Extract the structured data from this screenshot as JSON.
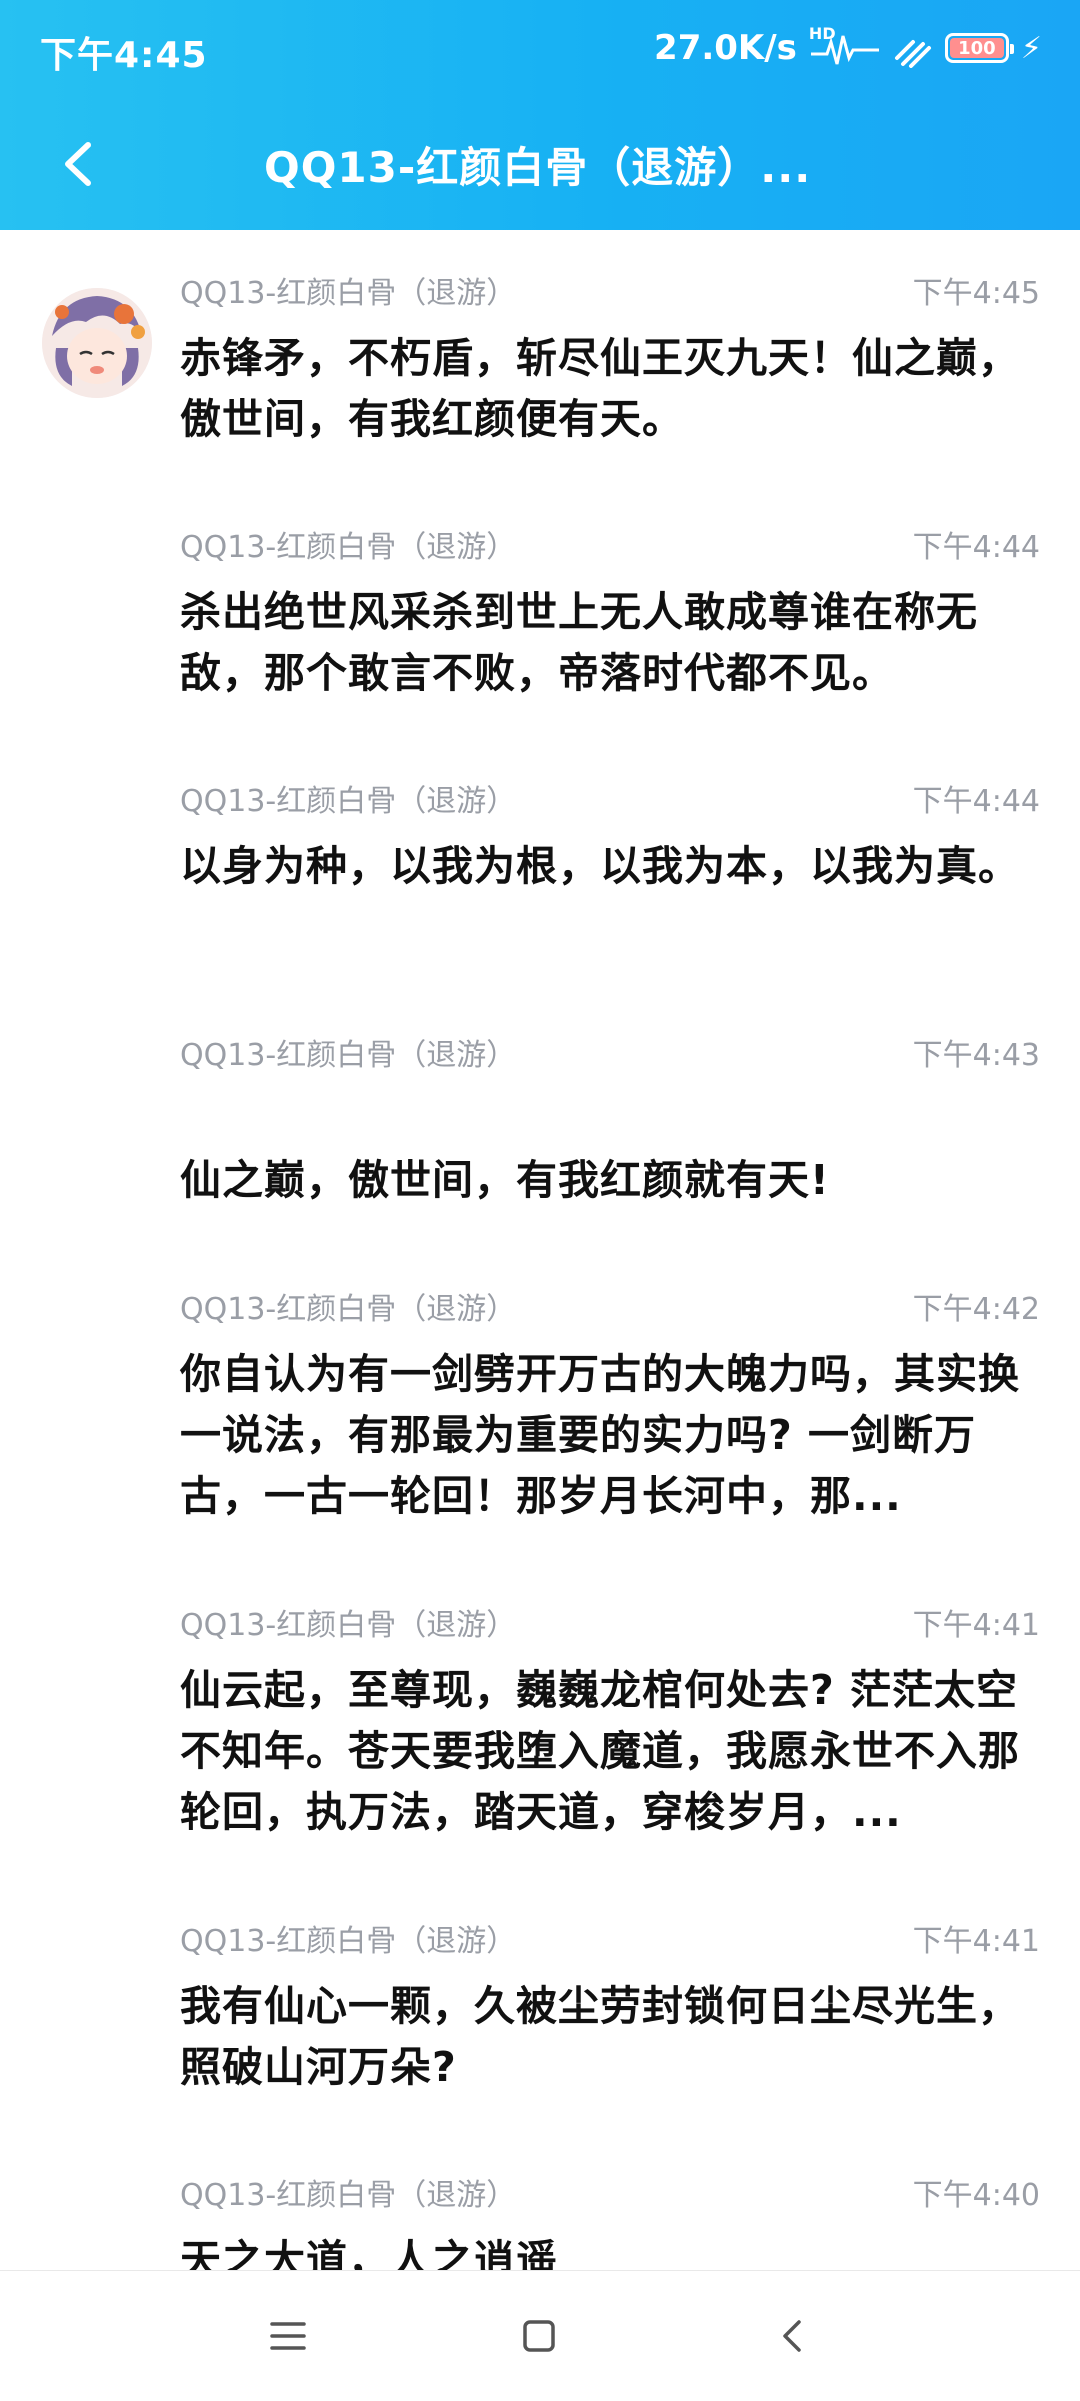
{
  "status_bar": {
    "time": "下午4:45",
    "net_speed": "27.0K/s",
    "hd_label": "HD",
    "battery": "100",
    "icons": [
      "hd-signal-icon",
      "wifi-icon",
      "battery-icon",
      "charging-icon"
    ]
  },
  "header": {
    "title": "QQ13-红颜白骨（退游）...",
    "back_icon": "chevron-left-icon",
    "color": "#1db4f4"
  },
  "messages": [
    {
      "sender": "QQ13-红颜白骨（退游）",
      "time": "下午4:45",
      "text": "赤锋矛，不朽盾，斩尽仙王灭九天！仙之巅，傲世间，有我红颜便有天。"
    },
    {
      "sender": "QQ13-红颜白骨（退游）",
      "time": "下午4:44",
      "text": "杀出绝世风采杀到世上无人敢成尊谁在称无敌，那个敢言不败，帝落时代都不见。"
    },
    {
      "sender": "QQ13-红颜白骨（退游）",
      "time": "下午4:44",
      "text": "以身为种，以我为根，以我为本，以我为真。"
    },
    {
      "sender": "QQ13-红颜白骨（退游）",
      "time": "下午4:43",
      "text": "仙之巅，傲世间，有我红颜就有天!"
    },
    {
      "sender": "QQ13-红颜白骨（退游）",
      "time": "下午4:42",
      "text": "你自认为有一剑劈开万古的大魄力吗，其实换一说法，有那最为重要的实力吗? 一剑断万古，一古一轮回！那岁月长河中，那..."
    },
    {
      "sender": "QQ13-红颜白骨（退游）",
      "time": "下午4:41",
      "text": "仙云起，至尊现，巍巍龙棺何处去? 茫茫太空不知年。苍天要我堕入魔道，我愿永世不入那轮回，执万法，踏天道，穿梭岁月，..."
    },
    {
      "sender": "QQ13-红颜白骨（退游）",
      "time": "下午4:41",
      "text": "我有仙心一颗，久被尘劳封锁何日尘尽光生，照破山河万朵?"
    },
    {
      "sender": "QQ13-红颜白骨（退游）",
      "time": "下午4:40",
      "text": "天之大道，人之逍遥"
    }
  ],
  "nav_bar": {
    "icons": [
      "menu-icon",
      "home-icon",
      "back-icon"
    ]
  }
}
